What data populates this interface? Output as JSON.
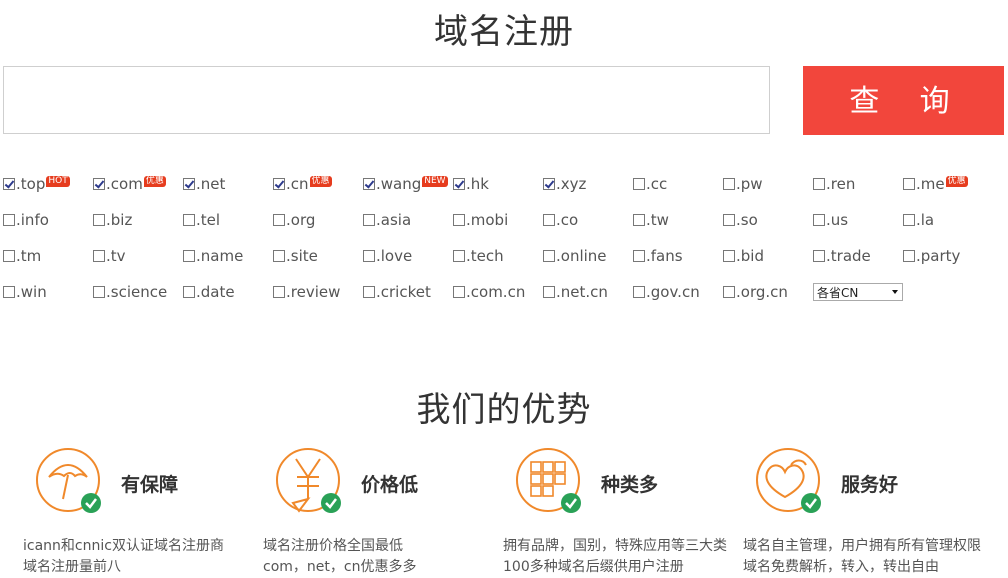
{
  "page_title": "域名注册",
  "search": {
    "placeholder": "",
    "button_label": "查 询"
  },
  "tlds": [
    {
      "label": ".top",
      "checked": true,
      "badge": "HOT"
    },
    {
      "label": ".com",
      "checked": true,
      "badge": "优惠"
    },
    {
      "label": ".net",
      "checked": true,
      "badge": ""
    },
    {
      "label": ".cn",
      "checked": true,
      "badge": "优惠"
    },
    {
      "label": ".wang",
      "checked": true,
      "badge": "NEW"
    },
    {
      "label": ".hk",
      "checked": true,
      "badge": ""
    },
    {
      "label": ".xyz",
      "checked": true,
      "badge": ""
    },
    {
      "label": ".cc",
      "checked": false,
      "badge": ""
    },
    {
      "label": ".pw",
      "checked": false,
      "badge": ""
    },
    {
      "label": ".ren",
      "checked": false,
      "badge": ""
    },
    {
      "label": ".me",
      "checked": false,
      "badge": "优惠"
    },
    {
      "label": ".info",
      "checked": false,
      "badge": ""
    },
    {
      "label": ".biz",
      "checked": false,
      "badge": ""
    },
    {
      "label": ".tel",
      "checked": false,
      "badge": ""
    },
    {
      "label": ".org",
      "checked": false,
      "badge": ""
    },
    {
      "label": ".asia",
      "checked": false,
      "badge": ""
    },
    {
      "label": ".mobi",
      "checked": false,
      "badge": ""
    },
    {
      "label": ".co",
      "checked": false,
      "badge": ""
    },
    {
      "label": ".tw",
      "checked": false,
      "badge": ""
    },
    {
      "label": ".so",
      "checked": false,
      "badge": ""
    },
    {
      "label": ".us",
      "checked": false,
      "badge": ""
    },
    {
      "label": ".la",
      "checked": false,
      "badge": ""
    },
    {
      "label": ".tm",
      "checked": false,
      "badge": ""
    },
    {
      "label": ".tv",
      "checked": false,
      "badge": ""
    },
    {
      "label": ".name",
      "checked": false,
      "badge": ""
    },
    {
      "label": ".site",
      "checked": false,
      "badge": ""
    },
    {
      "label": ".love",
      "checked": false,
      "badge": ""
    },
    {
      "label": ".tech",
      "checked": false,
      "badge": ""
    },
    {
      "label": ".online",
      "checked": false,
      "badge": ""
    },
    {
      "label": ".fans",
      "checked": false,
      "badge": ""
    },
    {
      "label": ".bid",
      "checked": false,
      "badge": ""
    },
    {
      "label": ".trade",
      "checked": false,
      "badge": ""
    },
    {
      "label": ".party",
      "checked": false,
      "badge": ""
    },
    {
      "label": ".win",
      "checked": false,
      "badge": ""
    },
    {
      "label": ".science",
      "checked": false,
      "badge": ""
    },
    {
      "label": ".date",
      "checked": false,
      "badge": ""
    },
    {
      "label": ".review",
      "checked": false,
      "badge": ""
    },
    {
      "label": ".cricket",
      "checked": false,
      "badge": ""
    },
    {
      "label": ".com.cn",
      "checked": false,
      "badge": ""
    },
    {
      "label": ".net.cn",
      "checked": false,
      "badge": ""
    },
    {
      "label": ".gov.cn",
      "checked": false,
      "badge": ""
    },
    {
      "label": ".org.cn",
      "checked": false,
      "badge": ""
    }
  ],
  "province_select": {
    "value": "各省CN"
  },
  "advantages": {
    "title": "我们的优势",
    "items": [
      {
        "icon": "umbrella-icon",
        "title": "有保障",
        "desc1": "icann和cnnic双认证域名注册商",
        "desc2": "域名注册量前八"
      },
      {
        "icon": "yuan-icon",
        "title": "价格低",
        "desc1": "域名注册价格全国最低",
        "desc2": "com，net，cn优惠多多"
      },
      {
        "icon": "grid-icon",
        "title": "种类多",
        "desc1": "拥有品牌，国别，特殊应用等三大类",
        "desc2": "100多种域名后缀供用户注册"
      },
      {
        "icon": "hearts-icon",
        "title": "服务好",
        "desc1": "域名自主管理，用户拥有所有管理权限",
        "desc2": "域名免费解析，转入，转出自由"
      }
    ]
  },
  "colors": {
    "accent": "#f2463c",
    "icon_orange": "#f0892b",
    "check_green": "#2aa157"
  }
}
